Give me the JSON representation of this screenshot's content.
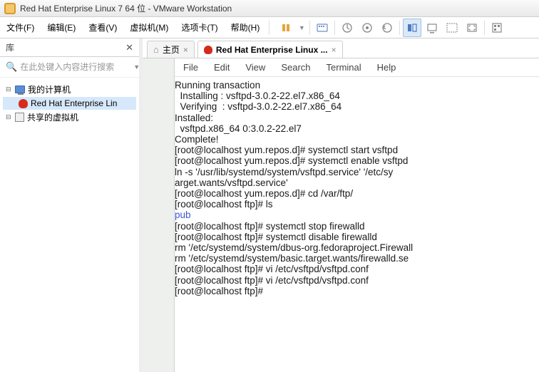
{
  "window": {
    "title": "Red Hat Enterprise Linux 7 64 位 - VMware Workstation"
  },
  "menubar": {
    "file": "文件(F)",
    "edit": "编辑(E)",
    "view": "查看(V)",
    "vm": "虚拟机(M)",
    "tabs": "选项卡(T)",
    "help": "帮助(H)"
  },
  "sidebar": {
    "title": "库",
    "search_placeholder": "在此处键入内容进行搜索",
    "items": [
      {
        "label": "我的计算机",
        "expanded": true
      },
      {
        "label": "Red Hat Enterprise Lin"
      },
      {
        "label": "共享的虚拟机",
        "expanded": true
      }
    ]
  },
  "tabs": {
    "home": "主页",
    "vm": "Red Hat Enterprise Linux ..."
  },
  "gnome_menu": {
    "file": "File",
    "edit": "Edit",
    "view": "View",
    "search": "Search",
    "terminal": "Terminal",
    "help": "Help"
  },
  "terminal_lines": [
    {
      "t": "Running transaction"
    },
    {
      "t": "  Installing : vsftpd-3.0.2-22.el7.x86_64"
    },
    {
      "t": "  Verifying  : vsftpd-3.0.2-22.el7.x86_64"
    },
    {
      "t": ""
    },
    {
      "t": "Installed:"
    },
    {
      "t": "  vsftpd.x86_64 0:3.0.2-22.el7"
    },
    {
      "t": ""
    },
    {
      "t": "Complete!"
    },
    {
      "t": "[root@localhost yum.repos.d]# systemctl start vsftpd"
    },
    {
      "t": "[root@localhost yum.repos.d]# systemctl enable vsftpd"
    },
    {
      "t": "ln -s '/usr/lib/systemd/system/vsftpd.service' '/etc/sy"
    },
    {
      "t": "arget.wants/vsftpd.service'"
    },
    {
      "t": "[root@localhost yum.repos.d]# cd /var/ftp/"
    },
    {
      "t": "[root@localhost ftp]# ls"
    },
    {
      "t": "pub",
      "c": "term-blue"
    },
    {
      "t": "[root@localhost ftp]# systemctl stop firewalld"
    },
    {
      "t": "[root@localhost ftp]# systemctl disable firewalld"
    },
    {
      "t": "rm '/etc/systemd/system/dbus-org.fedoraproject.Firewall"
    },
    {
      "t": "rm '/etc/systemd/system/basic.target.wants/firewalld.se"
    },
    {
      "t": "[root@localhost ftp]# vi /etc/vsftpd/vsftpd.conf"
    },
    {
      "t": "[root@localhost ftp]# vi /etc/vsftpd/vsftpd.conf"
    },
    {
      "t": "[root@localhost ftp]# "
    }
  ]
}
